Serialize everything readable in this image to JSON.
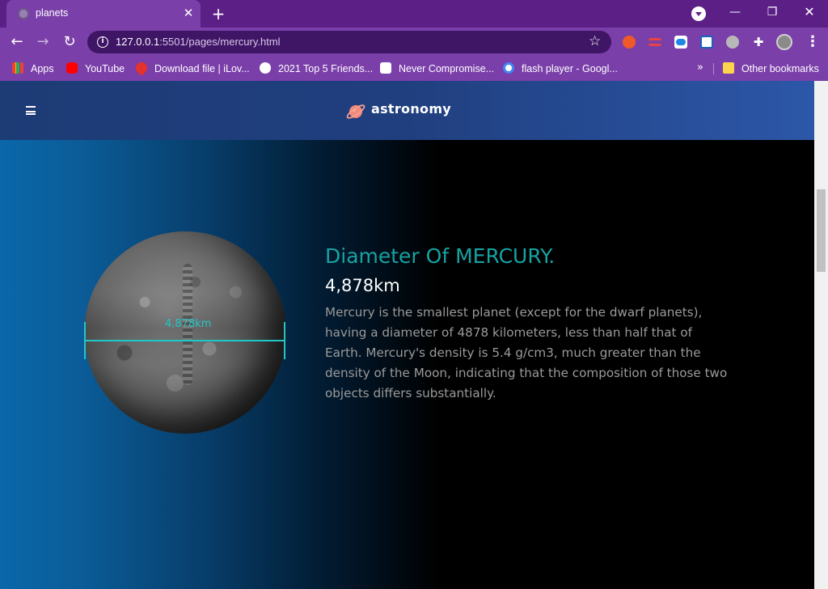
{
  "browser": {
    "tab": {
      "title": "planets"
    },
    "url": {
      "host": "127.0.0.1",
      "path": ":5501/pages/mercury.html"
    },
    "bookmarks": [
      {
        "label": "Apps",
        "icon": "apps-grid-icon"
      },
      {
        "label": "YouTube",
        "icon": "youtube-icon"
      },
      {
        "label": "Download file | iLov...",
        "icon": "ilovepdf-icon"
      },
      {
        "label": "2021 Top 5 Friends...",
        "icon": "globe-icon"
      },
      {
        "label": "Never Compromise...",
        "icon": "shield-icon"
      },
      {
        "label": "flash player - Googl...",
        "icon": "google-icon"
      }
    ],
    "more_bookmarks": "»",
    "other_bookmarks": "Other bookmarks"
  },
  "site": {
    "logo": "astronomy",
    "section": {
      "title": "Diameter Of MERCURY.",
      "value": "4,878km",
      "diagram_label": "4,878km",
      "text": "Mercury is the smallest planet (except for the dwarf planets), having a diameter of 4878 kilometers, less than half that of Earth. Mercury's density is 5.4 g/cm3, much greater than the density of the Moon, indicating that the composition of those two objects differs substantially."
    }
  },
  "colors": {
    "chrome": "#7a3fa9",
    "accent": "#17a2a2",
    "header_gradient_start": "#1d3b75",
    "header_gradient_end": "#2c57a8"
  }
}
